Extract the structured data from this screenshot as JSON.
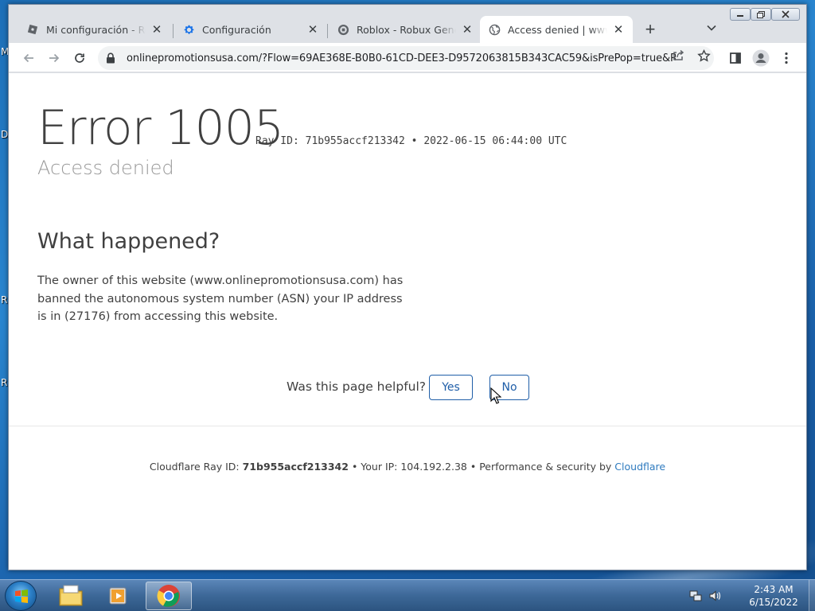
{
  "desktop": {
    "fragments": [
      "M",
      "D",
      "R",
      "R"
    ]
  },
  "browser": {
    "tabs": [
      {
        "label": "Mi configuración - Roblox",
        "icon": "roblox-icon",
        "active": false
      },
      {
        "label": "Configuración",
        "icon": "gear-icon",
        "active": false
      },
      {
        "label": "Roblox - Robux Generator",
        "icon": "roblox-circle-icon",
        "active": false
      },
      {
        "label": "Access denied | www.onlinepromotionsusa.com",
        "icon": "globe-icon",
        "active": true
      }
    ],
    "new_tab_label": "+",
    "url": "onlinepromotionsusa.com/?Flow=69AE368E-B0B0-61CD-DEE3-D9572063815B343CAC59&isPrePop=true&R..."
  },
  "page": {
    "error_title": "Error 1005",
    "ray_line": "Ray ID: 71b955accf213342 • 2022-06-15 06:44:00 UTC",
    "subtitle": "Access denied",
    "what_happened": "What happened?",
    "explanation": "The owner of this website (www.onlinepromotionsusa.com) has banned the autonomous system number (ASN) your IP address is in (27176) from accessing this website.",
    "helpful_question": "Was this page helpful?",
    "yes_label": "Yes",
    "no_label": "No",
    "footer": {
      "ray_prefix": "Cloudflare Ray ID:",
      "ray_id": "71b955accf213342",
      "ip_text": "• Your IP: 104.192.2.38 •",
      "perf_text": "Performance & security by",
      "cloudflare_link": "Cloudflare"
    }
  },
  "taskbar": {
    "time": "2:43 AM",
    "date": "6/15/2022"
  },
  "colors": {
    "link_blue": "#2f7bbf",
    "button_blue": "#1f5ea8",
    "text": "#404040"
  }
}
